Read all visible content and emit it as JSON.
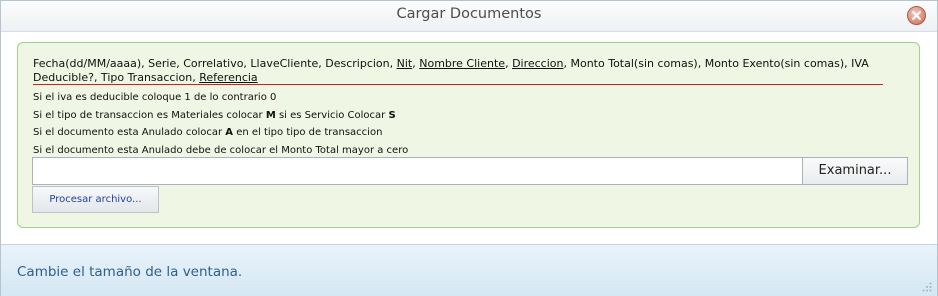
{
  "window": {
    "title": "Cargar Documentos",
    "footer_text": "Cambie el tamaño de la ventana."
  },
  "instructions": {
    "format_parts": [
      {
        "text": "Fecha(dd/MM/aaaa), Serie, Correlativo, LlaveCliente, Descripcion, ",
        "underline": false
      },
      {
        "text": "Nit",
        "underline": true
      },
      {
        "text": ", ",
        "underline": false
      },
      {
        "text": "Nombre Cliente",
        "underline": true
      },
      {
        "text": ", ",
        "underline": false
      },
      {
        "text": "Direccion",
        "underline": true
      },
      {
        "text": ", Monto Total(sin comas), Monto Exento(sin comas), IVA Deducible?, Tipo Transaccion, ",
        "underline": false
      },
      {
        "text": "Referencia",
        "underline": true
      }
    ],
    "line1": "Si el iva es deducible coloque 1 de lo contrario 0",
    "line2_pre": "Si el tipo de transaccion es Materiales colocar ",
    "line2_b1": "M",
    "line2_mid": " si es Servicio Colocar ",
    "line2_b2": "S",
    "line3_pre": "Si el documento esta Anulado colocar ",
    "line3_b": "A",
    "line3_post": " en el tipo tipo de transaccion",
    "line4": "Si el documento esta Anulado debe de colocar el Monto Total mayor a cero"
  },
  "upload": {
    "file_value": "",
    "browse_label": "Examinar...",
    "process_label": "Procesar archivo..."
  },
  "icons": {
    "close": "close-icon",
    "resize": "resize-grip-icon"
  }
}
